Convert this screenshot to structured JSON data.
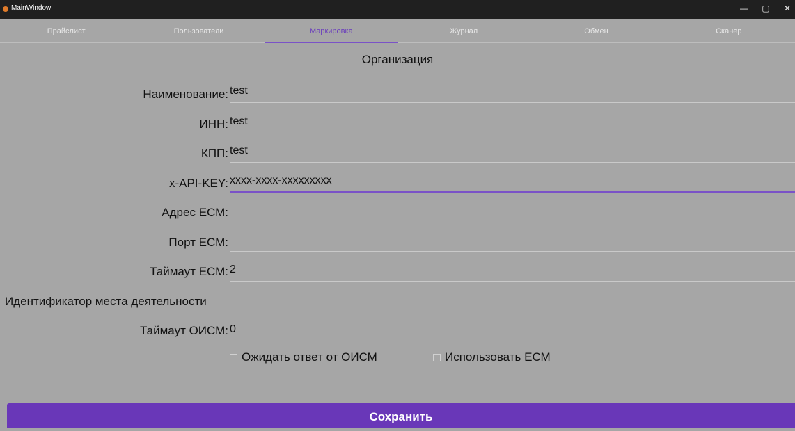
{
  "window": {
    "title": "MainWindow",
    "minimize_glyph": "—",
    "maximize_glyph": "▢",
    "close_glyph": "✕"
  },
  "tabs": [
    {
      "label": "Прайслист",
      "active": false
    },
    {
      "label": "Пользователи",
      "active": false
    },
    {
      "label": "Маркировка",
      "active": true
    },
    {
      "label": "Журнал",
      "active": false
    },
    {
      "label": "Обмен",
      "active": false
    },
    {
      "label": "Сканер",
      "active": false
    }
  ],
  "section": {
    "title": "Организация"
  },
  "form": {
    "name": {
      "label": "Наименование:",
      "value": "test"
    },
    "inn": {
      "label": "ИНН:",
      "value": "test"
    },
    "kpp": {
      "label": "КПП:",
      "value": "test"
    },
    "api_key": {
      "label": "x-API-KEY:",
      "value": "xxxx-xxxx-xxxxxxxxx"
    },
    "ecm_address": {
      "label": "Адрес ЕСМ:",
      "value": ""
    },
    "ecm_port": {
      "label": "Порт ЕСМ:",
      "value": ""
    },
    "ecm_timeout": {
      "label": "Таймаут ЕСМ:",
      "value": "2"
    },
    "place_id": {
      "label": "Идентификатор места деятельности",
      "value": ""
    },
    "oism_timeout": {
      "label": "Таймаут ОИСМ:",
      "value": "0"
    }
  },
  "checkboxes": {
    "wait_oism": {
      "label": "Ожидать ответ от ОИСМ",
      "checked": false
    },
    "use_ecm": {
      "label": "Использовать ЕСМ",
      "checked": false
    }
  },
  "actions": {
    "save_label": "Сохранить"
  },
  "colors": {
    "background": "#a6a6a6",
    "accent": "#7a52c7",
    "button": "#6937b8",
    "titlebar": "#202020"
  }
}
